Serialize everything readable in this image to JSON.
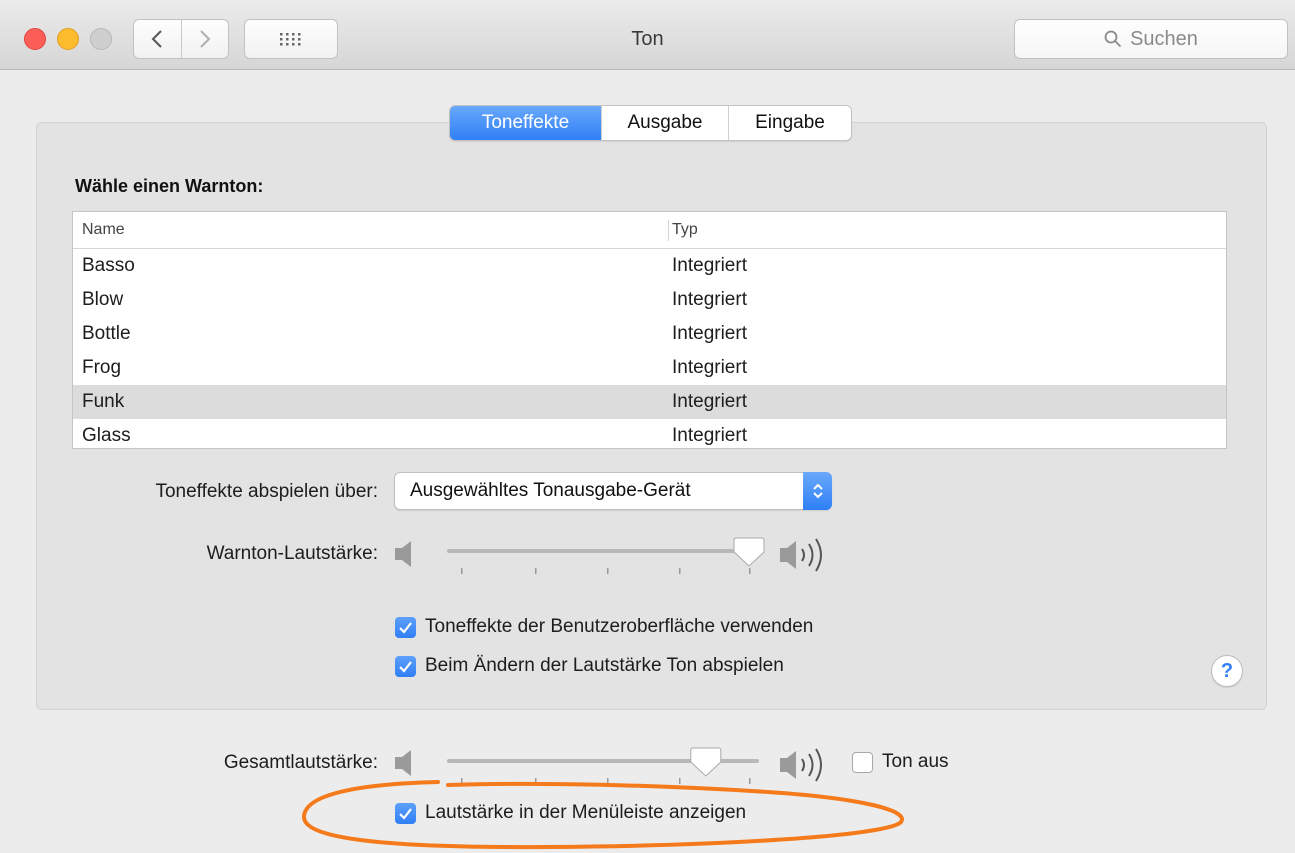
{
  "window": {
    "title": "Ton",
    "search_placeholder": "Suchen"
  },
  "tabs": [
    {
      "label": "Toneffekte",
      "active": true
    },
    {
      "label": "Ausgabe",
      "active": false
    },
    {
      "label": "Eingabe",
      "active": false
    }
  ],
  "alert_sounds": {
    "heading": "Wähle einen Warnton:",
    "columns": {
      "name": "Name",
      "type": "Typ"
    },
    "rows": [
      {
        "name": "Basso",
        "type": "Integriert"
      },
      {
        "name": "Blow",
        "type": "Integriert"
      },
      {
        "name": "Bottle",
        "type": "Integriert"
      },
      {
        "name": "Frog",
        "type": "Integriert"
      },
      {
        "name": "Funk",
        "type": "Integriert",
        "selected": true
      },
      {
        "name": "Glass",
        "type": "Integriert"
      }
    ]
  },
  "play_through": {
    "label": "Toneffekte abspielen über:",
    "selected": "Ausgewähltes Tonausgabe-Gerät"
  },
  "alert_volume": {
    "label": "Warnton-Lautstärke:",
    "value": 1.0
  },
  "checkboxes": {
    "ui_sounds": {
      "label": "Toneffekte der Benutzeroberfläche verwenden",
      "checked": true
    },
    "feedback": {
      "label": "Beim Ändern der Lautstärke Ton abspielen",
      "checked": true
    },
    "menubar": {
      "label": "Lautstärke in der Menüleiste anzeigen",
      "checked": true
    },
    "mute": {
      "label": "Ton aus",
      "checked": false
    }
  },
  "output_volume": {
    "label": "Gesamtlautstärke:",
    "value": 0.85
  },
  "help_label": "?",
  "colors": {
    "accent": "#2f7ff5",
    "highlight_circle": "#f57a1c",
    "selected_row": "#dcdcdc"
  }
}
